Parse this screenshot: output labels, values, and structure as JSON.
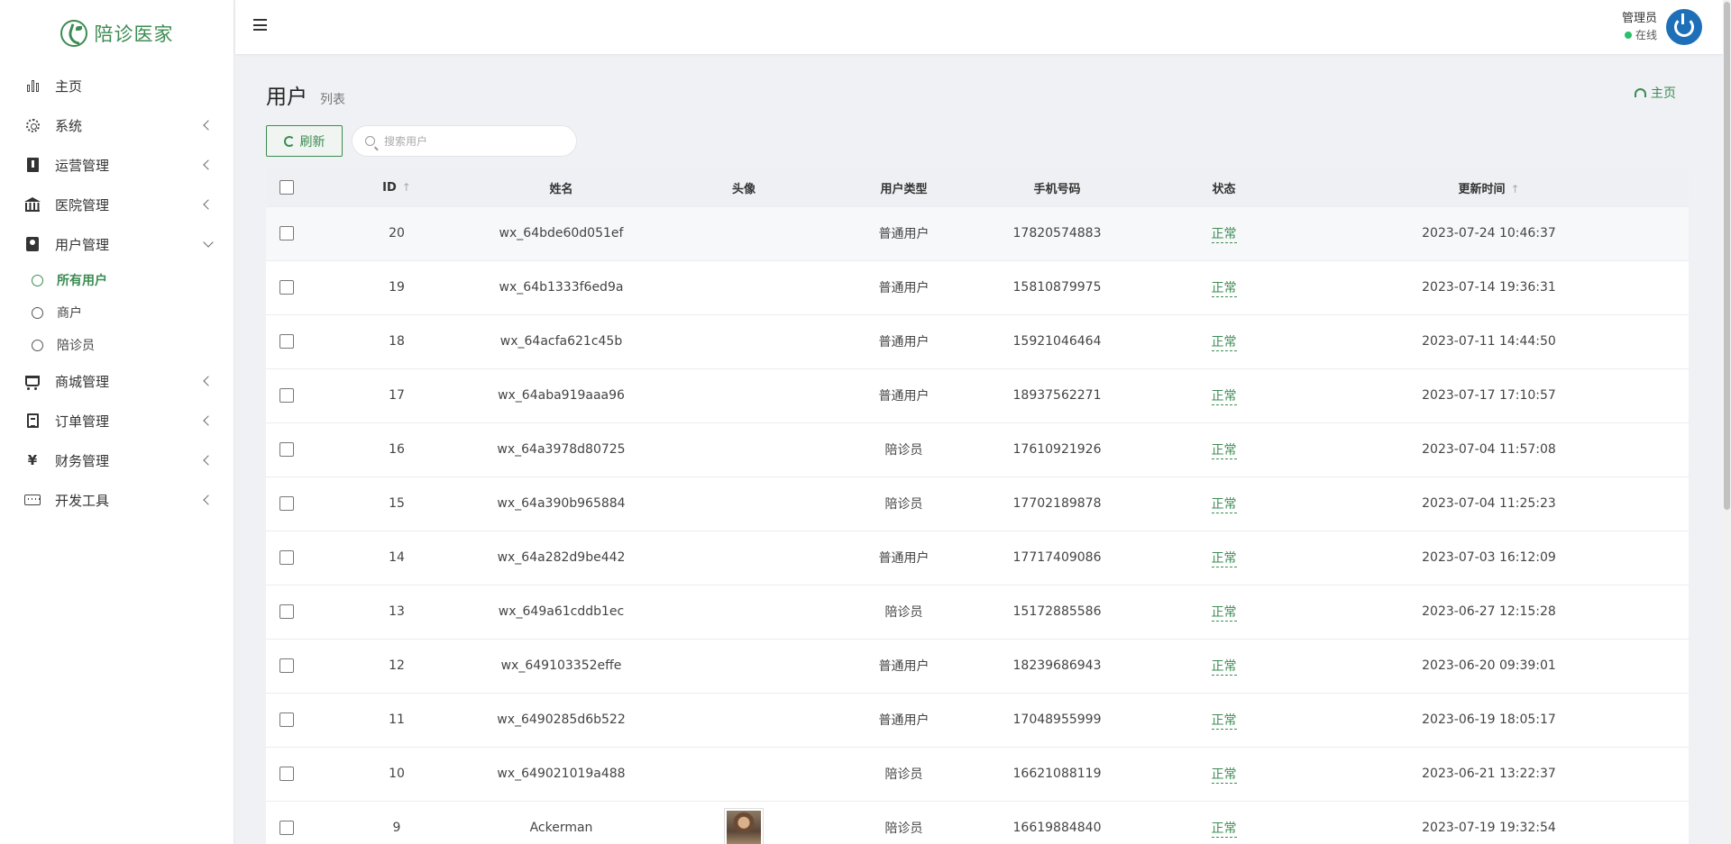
{
  "brand": {
    "name": "陪诊医家"
  },
  "sidebar": {
    "items": [
      {
        "label": "主页",
        "icon": "bar-chart-icon",
        "expandable": false
      },
      {
        "label": "系统",
        "icon": "gear-icon",
        "expandable": true
      },
      {
        "label": "运营管理",
        "icon": "book-icon",
        "expandable": true
      },
      {
        "label": "医院管理",
        "icon": "bank-icon",
        "expandable": true
      },
      {
        "label": "用户管理",
        "icon": "contact-icon",
        "expandable": true,
        "expanded": true,
        "children": [
          {
            "label": "所有用户",
            "active": true
          },
          {
            "label": "商户"
          },
          {
            "label": "陪诊员"
          }
        ]
      },
      {
        "label": "商城管理",
        "icon": "cart-icon",
        "expandable": true
      },
      {
        "label": "订单管理",
        "icon": "document-icon",
        "expandable": true
      },
      {
        "label": "财务管理",
        "icon": "yen-icon",
        "expandable": true
      },
      {
        "label": "开发工具",
        "icon": "keyboard-icon",
        "expandable": true
      }
    ]
  },
  "header": {
    "user": {
      "name": "管理员",
      "status": "在线"
    }
  },
  "page": {
    "title": "用户",
    "subtitle": "列表",
    "home_link": "主页"
  },
  "toolbar": {
    "refresh_label": "刷新",
    "search_placeholder": "搜索用户"
  },
  "table": {
    "columns": [
      "ID",
      "姓名",
      "头像",
      "用户类型",
      "手机号码",
      "状态",
      "更新时间"
    ],
    "rows": [
      {
        "id": "20",
        "name": "wx_64bde60d051ef",
        "avatar": false,
        "type": "普通用户",
        "phone": "17820574883",
        "status": "正常",
        "updated": "2023-07-24 10:46:37"
      },
      {
        "id": "19",
        "name": "wx_64b1333f6ed9a",
        "avatar": false,
        "type": "普通用户",
        "phone": "15810879975",
        "status": "正常",
        "updated": "2023-07-14 19:36:31"
      },
      {
        "id": "18",
        "name": "wx_64acfa621c45b",
        "avatar": false,
        "type": "普通用户",
        "phone": "15921046464",
        "status": "正常",
        "updated": "2023-07-11 14:44:50"
      },
      {
        "id": "17",
        "name": "wx_64aba919aaa96",
        "avatar": false,
        "type": "普通用户",
        "phone": "18937562271",
        "status": "正常",
        "updated": "2023-07-17 17:10:57"
      },
      {
        "id": "16",
        "name": "wx_64a3978d80725",
        "avatar": false,
        "type": "陪诊员",
        "phone": "17610921926",
        "status": "正常",
        "updated": "2023-07-04 11:57:08"
      },
      {
        "id": "15",
        "name": "wx_64a390b965884",
        "avatar": false,
        "type": "陪诊员",
        "phone": "17702189878",
        "status": "正常",
        "updated": "2023-07-04 11:25:23"
      },
      {
        "id": "14",
        "name": "wx_64a282d9be442",
        "avatar": false,
        "type": "普通用户",
        "phone": "17717409086",
        "status": "正常",
        "updated": "2023-07-03 16:12:09"
      },
      {
        "id": "13",
        "name": "wx_649a61cddb1ec",
        "avatar": false,
        "type": "陪诊员",
        "phone": "15172885586",
        "status": "正常",
        "updated": "2023-06-27 12:15:28"
      },
      {
        "id": "12",
        "name": "wx_649103352effe",
        "avatar": false,
        "type": "普通用户",
        "phone": "18239686943",
        "status": "正常",
        "updated": "2023-06-20 09:39:01"
      },
      {
        "id": "11",
        "name": "wx_6490285d6b522",
        "avatar": false,
        "type": "普通用户",
        "phone": "17048955999",
        "status": "正常",
        "updated": "2023-06-19 18:05:17"
      },
      {
        "id": "10",
        "name": "wx_649021019a488",
        "avatar": false,
        "type": "陪诊员",
        "phone": "16621088119",
        "status": "正常",
        "updated": "2023-06-21 13:22:37"
      },
      {
        "id": "9",
        "name": "Ackerman",
        "avatar": true,
        "type": "陪诊员",
        "phone": "16619884840",
        "status": "正常",
        "updated": "2023-07-19 19:32:54"
      }
    ]
  },
  "colors": {
    "accent": "#3c8b52",
    "online": "#2bbf6a",
    "avatar_bg": "#1d6fb8"
  }
}
